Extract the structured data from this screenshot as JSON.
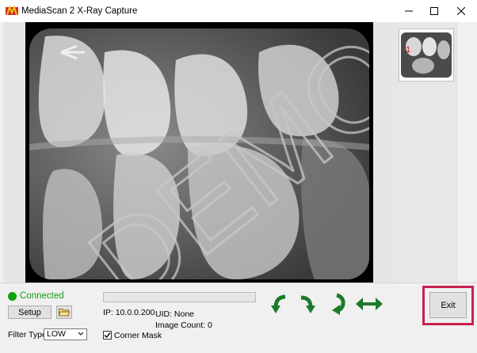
{
  "window": {
    "title": "MediaScan 2 X-Ray Capture",
    "controls": {
      "minimize": "–",
      "maximize": "☐",
      "close": "✕"
    }
  },
  "image": {
    "watermark": "DEMO"
  },
  "thumbnails": [
    {
      "number": "1"
    }
  ],
  "status": {
    "text": "Connected",
    "color": "#10a010"
  },
  "buttons": {
    "setup": "Setup",
    "exit": "Exit"
  },
  "progress": {
    "fraction": 0.0
  },
  "device": {
    "ip": "IP: 10.0.0.200",
    "uid": "UID: None",
    "image_count": "Image Count: 0"
  },
  "filter": {
    "label": "Filter Type:",
    "value": "LOW"
  },
  "corner_mask": {
    "label": "Corner Mask",
    "checked": true
  },
  "colors": {
    "accent_green": "#1d7a2b",
    "highlight": "#c8214f"
  },
  "icons": [
    "folder-open-icon",
    "rotate-left-icon",
    "rotate-right-icon",
    "rotate-180-icon",
    "flip-horizontal-icon"
  ]
}
